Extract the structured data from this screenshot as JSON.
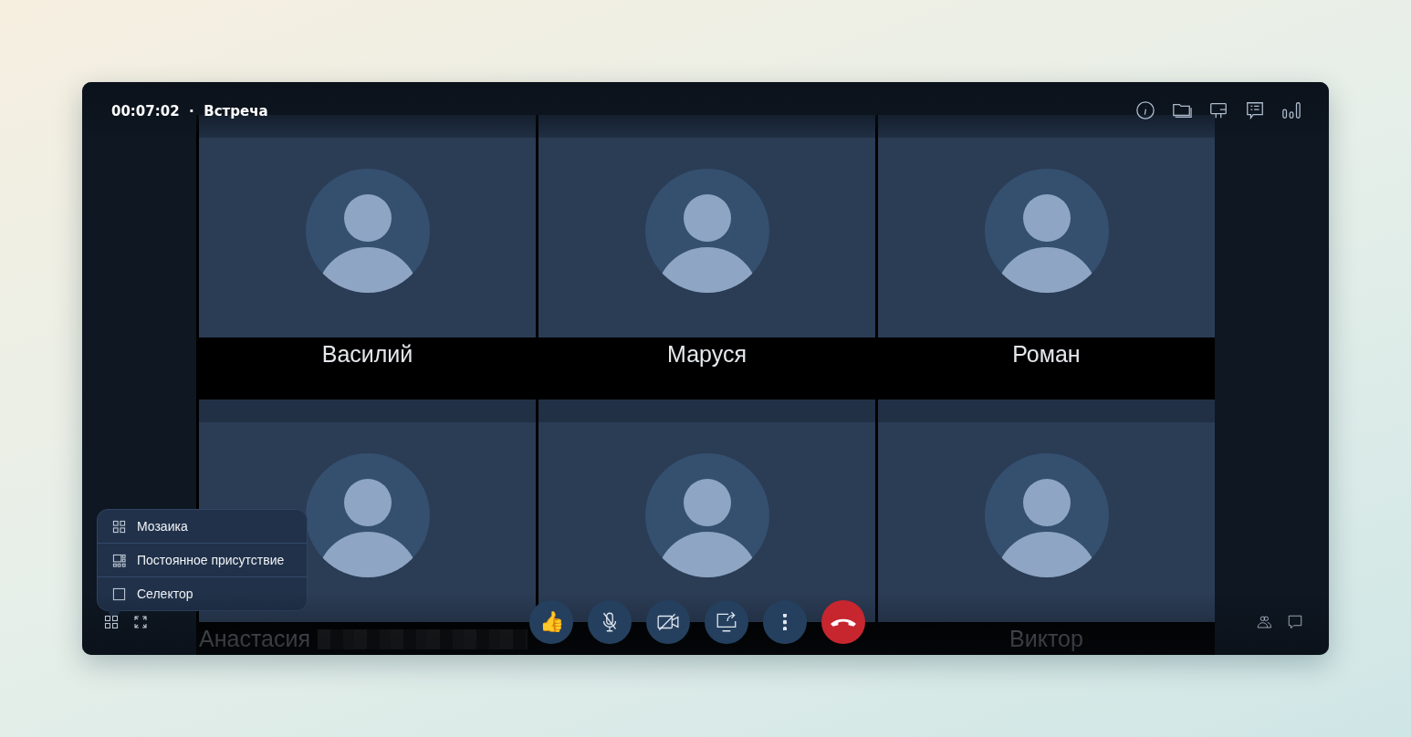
{
  "header": {
    "timer": "00:07:02",
    "separator": "·",
    "title": "Встреча"
  },
  "participants": [
    {
      "name": "Василий",
      "blurred_suffix": false
    },
    {
      "name": "Маруся",
      "blurred_suffix": false
    },
    {
      "name": "Роман",
      "blurred_suffix": false
    },
    {
      "name": "Анастасия",
      "blurred_suffix": true
    },
    {
      "blurred_suffix": false
    },
    {
      "name": "Виктор",
      "blurred_suffix": false
    }
  ],
  "layout_menu": [
    {
      "label": "Мозаика",
      "kind": "grid"
    },
    {
      "label": "Постоянное присутствие",
      "kind": "presence"
    },
    {
      "label": "Селектор",
      "kind": "single"
    }
  ],
  "reaction": {
    "emoji": "👍"
  }
}
